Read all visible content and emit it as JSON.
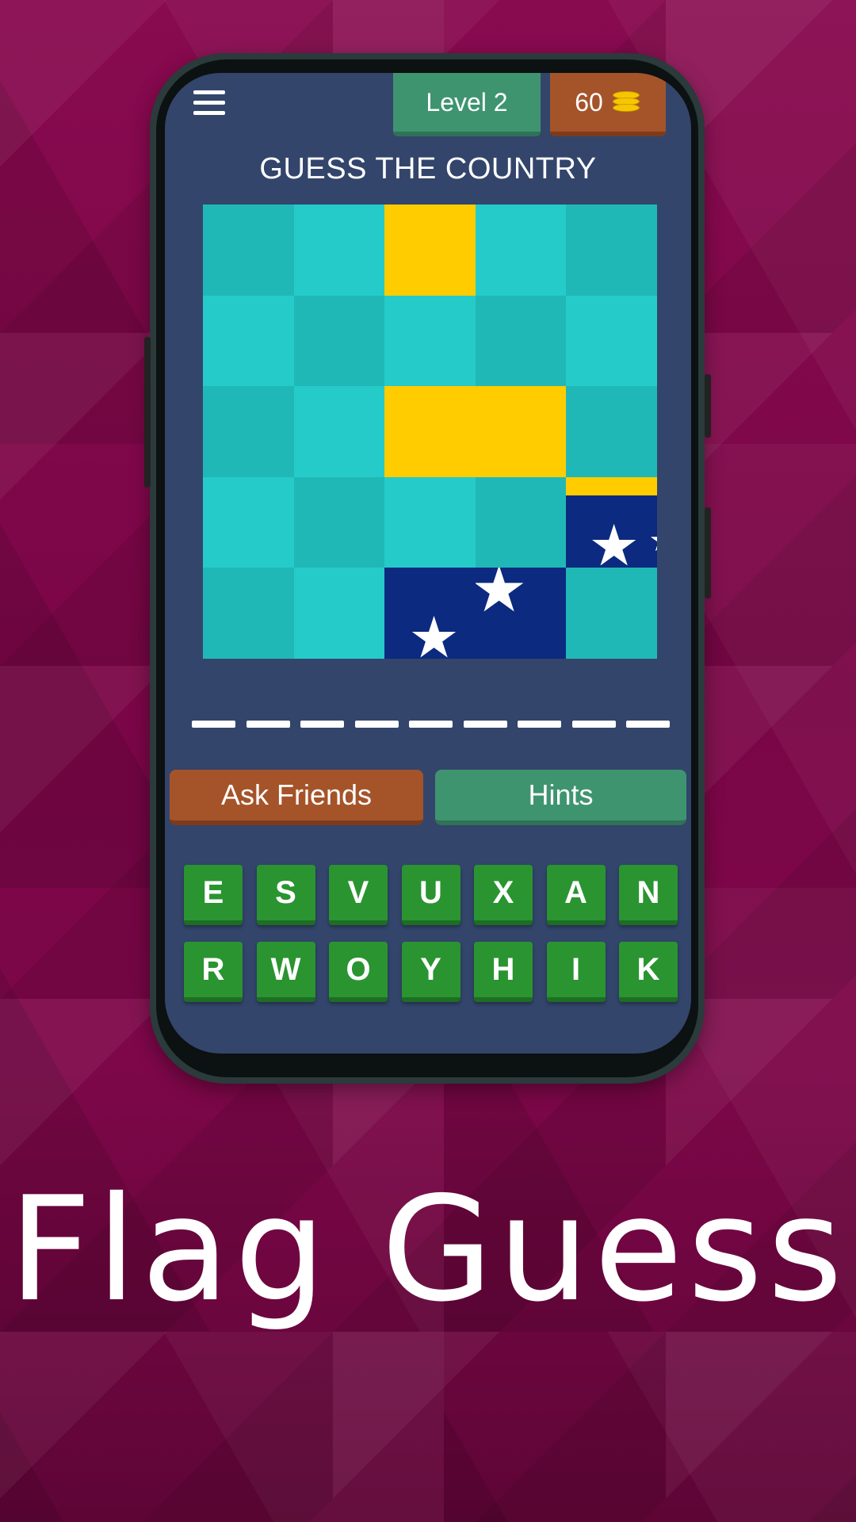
{
  "header": {
    "menu_icon": "hamburger-menu-icon",
    "level_label": "Level 2",
    "coins": "60",
    "coins_icon": "coin-stack-icon"
  },
  "game": {
    "title": "GUESS THE COUNTRY",
    "flag_tiles_note": "5x5 grid of tiles; revealed tiles show parts of a flag",
    "answer_slots": 9
  },
  "actions": {
    "ask_friends_label": "Ask Friends",
    "hints_label": "Hints"
  },
  "keyboard": {
    "row1": [
      "E",
      "S",
      "V",
      "U",
      "X",
      "A",
      "N"
    ],
    "row2": [
      "R",
      "W",
      "O",
      "Y",
      "H",
      "I",
      "K"
    ]
  },
  "footer": {
    "app_name": "Flag Guess"
  },
  "colors": {
    "background": "#7a0647",
    "screen": "#33456b",
    "tile_teal": "#25cbc9",
    "flag_gold": "#ffcc00",
    "flag_blue": "#0c2a7f",
    "level_badge": "#3f9470",
    "coin_badge": "#a5542a",
    "key_green": "#2a9431"
  }
}
